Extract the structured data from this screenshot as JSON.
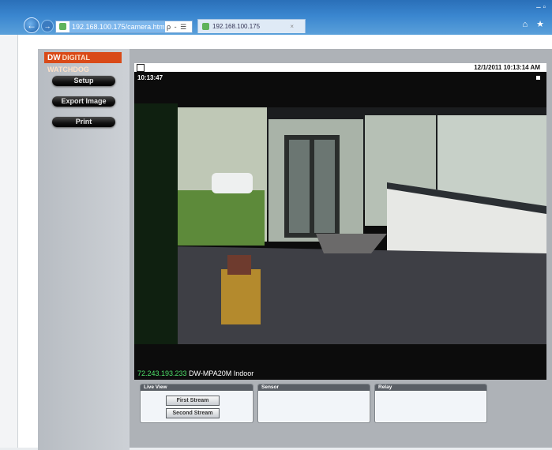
{
  "browser": {
    "back_glyph": "←",
    "forward_glyph": "→",
    "address_url": "192.168.100.175/camera.html",
    "address_controls": "ρ - ☰ → ✕",
    "tab_title": "192.168.100.175",
    "tab_close": "×",
    "window_controls": "– ▫",
    "right_glyphs": "⌂ ★"
  },
  "sidebar": {
    "logo_dw": "DW",
    "logo_text": "DIGITAL WATCHDOG",
    "buttons": [
      "Setup",
      "Export Image",
      "Print"
    ]
  },
  "camera": {
    "header_datetime": "12/1/2011   10:13:14 AM",
    "overlay_time": "10:13:47",
    "caption_ip": "72.243.193.233",
    "caption_name": "DW-MPA20M Indoor"
  },
  "panels": {
    "live_view": {
      "title": "Live View",
      "buttons": [
        "First Stream",
        "Second Stream"
      ]
    },
    "sensor": {
      "title": "Sensor"
    },
    "relay": {
      "title": "Relay"
    }
  },
  "colors": {
    "titlebar": "#3a86cf",
    "logo": "#d94a18",
    "caption_ip": "#4ee06a"
  }
}
